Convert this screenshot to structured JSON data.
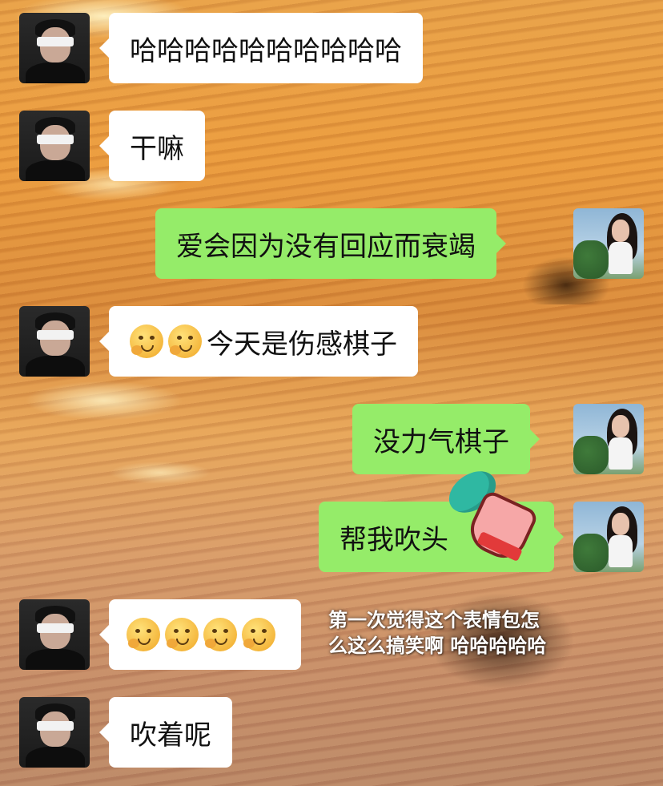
{
  "messages": [
    {
      "side": "left",
      "text": "哈哈哈哈哈哈哈哈哈哈"
    },
    {
      "side": "left",
      "text": "干嘛"
    },
    {
      "side": "right",
      "text": "爱会因为没有回应而衰竭"
    },
    {
      "side": "left",
      "emojis": [
        "thinking-hand-emoji",
        "thinking-hand-emoji"
      ],
      "text": "今天是伤感棋子"
    },
    {
      "side": "right",
      "text": "没力气棋子"
    },
    {
      "side": "right",
      "text": "帮我吹头",
      "sticker": "hair-dryer-glove-sticker"
    },
    {
      "side": "left",
      "emojis": [
        "blowing-emoji",
        "blowing-emoji",
        "blowing-emoji",
        "blowing-emoji"
      ],
      "text": ""
    },
    {
      "side": "left",
      "text": "吹着呢"
    }
  ],
  "caption": {
    "line1": "第一次觉得这个表情包怎",
    "line2": "么这么搞笑啊 哈哈哈哈哈"
  },
  "colors": {
    "left_bubble": "#ffffff",
    "right_bubble": "#95ec69",
    "background": "#e8a047"
  }
}
